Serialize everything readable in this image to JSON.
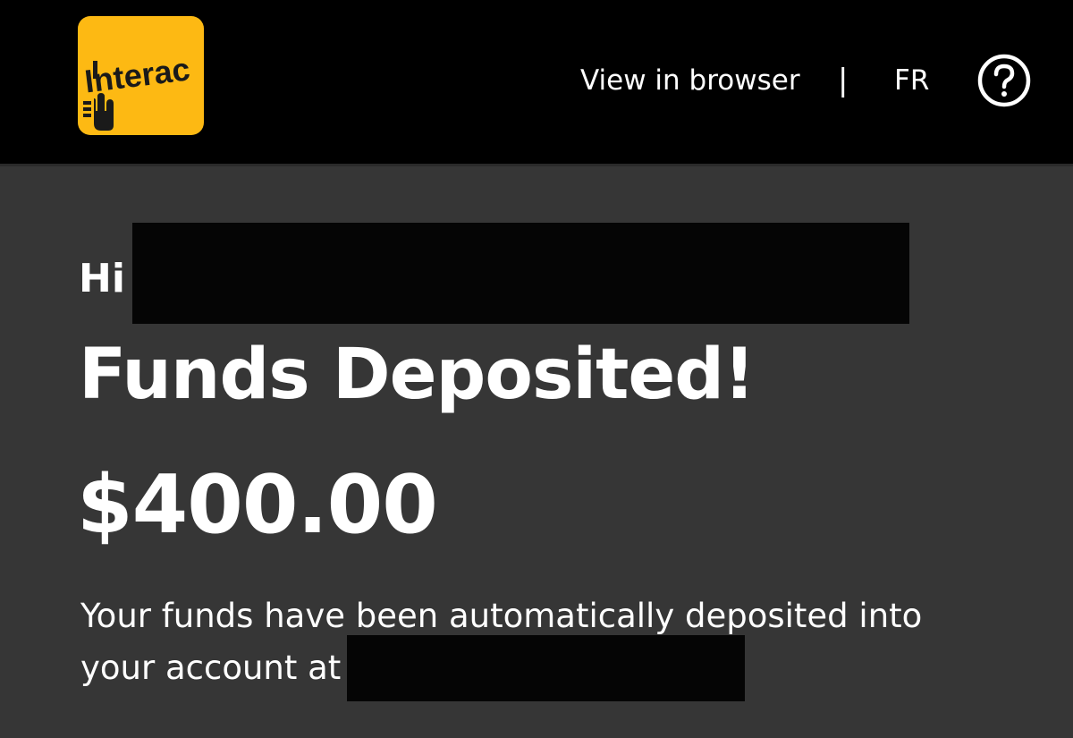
{
  "colors": {
    "background": "#363636",
    "header": "#000000",
    "brand": "#fdb913",
    "text": "#ffffff"
  },
  "header": {
    "logo_text": "Interac",
    "logo_icon": "interac-hand-logo",
    "view_in_browser": "View in browser",
    "separator": "|",
    "language": "FR",
    "help_icon": "question-circle-icon"
  },
  "main": {
    "greeting": "Hi",
    "title": "Funds Deposited!",
    "amount": "$400.00",
    "message_line1": "Your funds have been automatically deposited into",
    "message_line2": "your account at"
  }
}
